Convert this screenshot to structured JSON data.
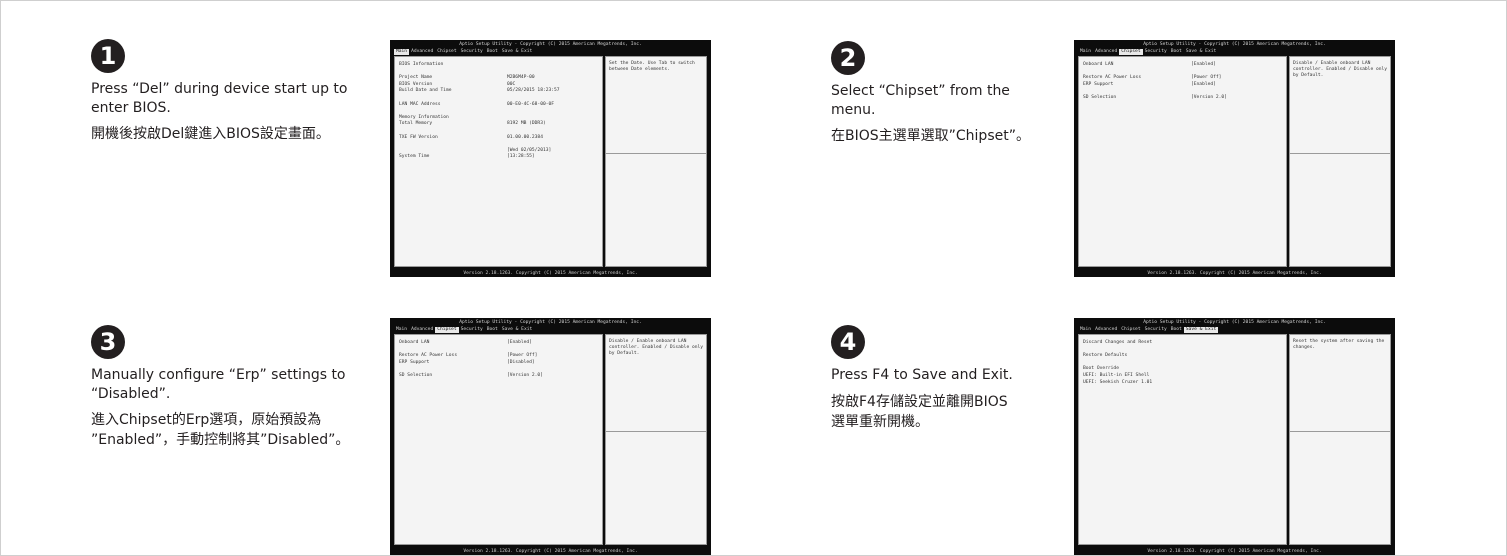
{
  "steps": [
    {
      "number": "1",
      "en_lines": [
        "Press “Del” during device start up to",
        "enter BIOS."
      ],
      "zh_lines": [
        "開機後按啟Del鍵進入BIOS設定畫面。"
      ]
    },
    {
      "number": "2",
      "en_lines": [
        "Select “Chipset” from the",
        "menu."
      ],
      "zh_lines": [
        "在BIOS主選單選取”Chipset”。"
      ]
    },
    {
      "number": "3",
      "en_lines": [
        "Manually configure “Erp” settings to",
        "“Disabled”."
      ],
      "zh_lines": [
        "進入Chipset的Erp選項，原始預設為",
        "”Enabled”，手動控制將其”Disabled”。"
      ]
    },
    {
      "number": "4",
      "en_lines": [
        "Press F4 to Save and Exit."
      ],
      "zh_lines": [
        "按啟F4存儲設定並離開BIOS",
        "選單重新開機。"
      ]
    }
  ],
  "bios": {
    "title": "Aptio Setup Utility - Copyright (C) 2015 American Megatrends, Inc.",
    "footer": "Version 2.18.1263. Copyright (C) 2015 American Megatrends, Inc.",
    "menu": [
      "Main",
      "Advanced",
      "Chipset",
      "Security",
      "Boot",
      "Save & Exit"
    ],
    "screens": [
      {
        "selected_tab": "Main",
        "rows": [
          [
            "BIOS Information",
            ""
          ],
          [
            "",
            ""
          ],
          [
            "Project Name",
            "M2B6M4P-00"
          ],
          [
            "BIOS Version",
            "00C"
          ],
          [
            "Build Date and Time",
            "05/28/2015 18:23:57"
          ],
          [
            "",
            ""
          ],
          [
            "LAN MAC Address",
            "00-E0-4C-68-00-0F"
          ],
          [
            "",
            ""
          ],
          [
            "Memory Information",
            ""
          ],
          [
            "Total Memory",
            "8192 MB (DDR3)"
          ],
          [
            "",
            ""
          ],
          [
            "TXE FW Version",
            "01.00.00.2384"
          ],
          [
            "",
            ""
          ],
          [
            "",
            "[Wed    02/05/2013]"
          ],
          [
            "System Time",
            "[13:28:55]"
          ]
        ],
        "help": "Set the Date. Use Tab to switch between Date elements."
      },
      {
        "selected_tab": "Chipset",
        "rows": [
          [
            "Onboard LAN",
            "[Enabled]"
          ],
          [
            "",
            ""
          ],
          [
            "Restore AC Power Loss",
            "[Power Off]"
          ],
          [
            "ERP Support",
            "[Enabled]"
          ],
          [
            "",
            ""
          ],
          [
            "SD Selection",
            "[Version 2.0]"
          ]
        ],
        "help": "Disable / Enable onboard LAN controller. Enabled / Disable only by Default."
      },
      {
        "selected_tab": "Chipset",
        "rows": [
          [
            "Onboard LAN",
            "[Enabled]"
          ],
          [
            "",
            ""
          ],
          [
            "Restore AC Power Loss",
            "[Power Off]"
          ],
          [
            "ERP Support",
            "[Disabled]"
          ],
          [
            "",
            ""
          ],
          [
            "SD Selection",
            "[Version 2.0]"
          ]
        ],
        "help": "Disable / Enable onboard LAN controller. Enabled / Disable only by Default."
      },
      {
        "selected_tab": "Save & Exit",
        "rows": [
          [
            "Discard Changes and Reset",
            ""
          ],
          [
            "",
            ""
          ],
          [
            "Restore Defaults",
            ""
          ],
          [
            "",
            ""
          ],
          [
            "Boot Override",
            ""
          ],
          [
            "UEFI: Built-in EFI Shell",
            ""
          ],
          [
            "UEFI: Seekish Cruzer 1.01",
            ""
          ]
        ],
        "help": "Reset the system after saving the changes."
      }
    ]
  },
  "colors": {
    "text": "#231f20",
    "badge": "#231f20",
    "bios_bg": "#0c0c0c",
    "bios_panel": "#f4f4f4"
  }
}
